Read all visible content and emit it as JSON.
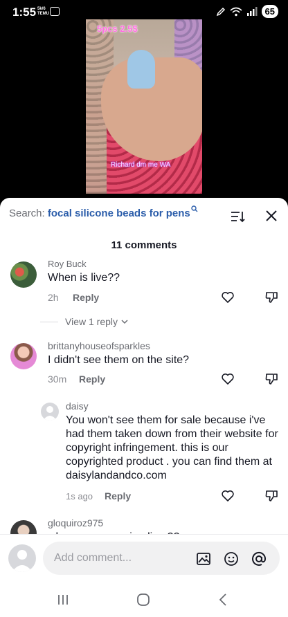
{
  "status": {
    "time": "1:55",
    "mini_top": "5k/6",
    "mini_bottom": "TEMU",
    "battery": "65"
  },
  "video": {
    "caption_top": "5pcs 2.5$",
    "caption_bottom": "Richard dm me WA"
  },
  "search": {
    "label": "Search:",
    "query": "focal silicone beads for pens"
  },
  "comments_count": "11 comments",
  "comments": [
    {
      "username": "Roy  Buck",
      "text": "When is live??",
      "time": "2h",
      "reply_label": "Reply",
      "view_replies": "View 1 reply"
    },
    {
      "username": "brittanyhouseofsparkles",
      "text": "I didn't see them on the site?",
      "time": "30m",
      "reply_label": "Reply"
    },
    {
      "username": "daisy",
      "text": "You won't see them for sale because i've had them taken down from their website for copyright infringement. this is our copyrighted product . you can find them at daisylandandco.com",
      "time": "1s ago",
      "reply_label": "Reply"
    },
    {
      "username": "gloquiroz975",
      "text": "when are you going live ??"
    }
  ],
  "input": {
    "placeholder": "Add comment..."
  },
  "colors": {
    "search_query": "#2b5daa",
    "sheet_bg": "#ffffff",
    "input_bg": "#f1f1f2"
  }
}
